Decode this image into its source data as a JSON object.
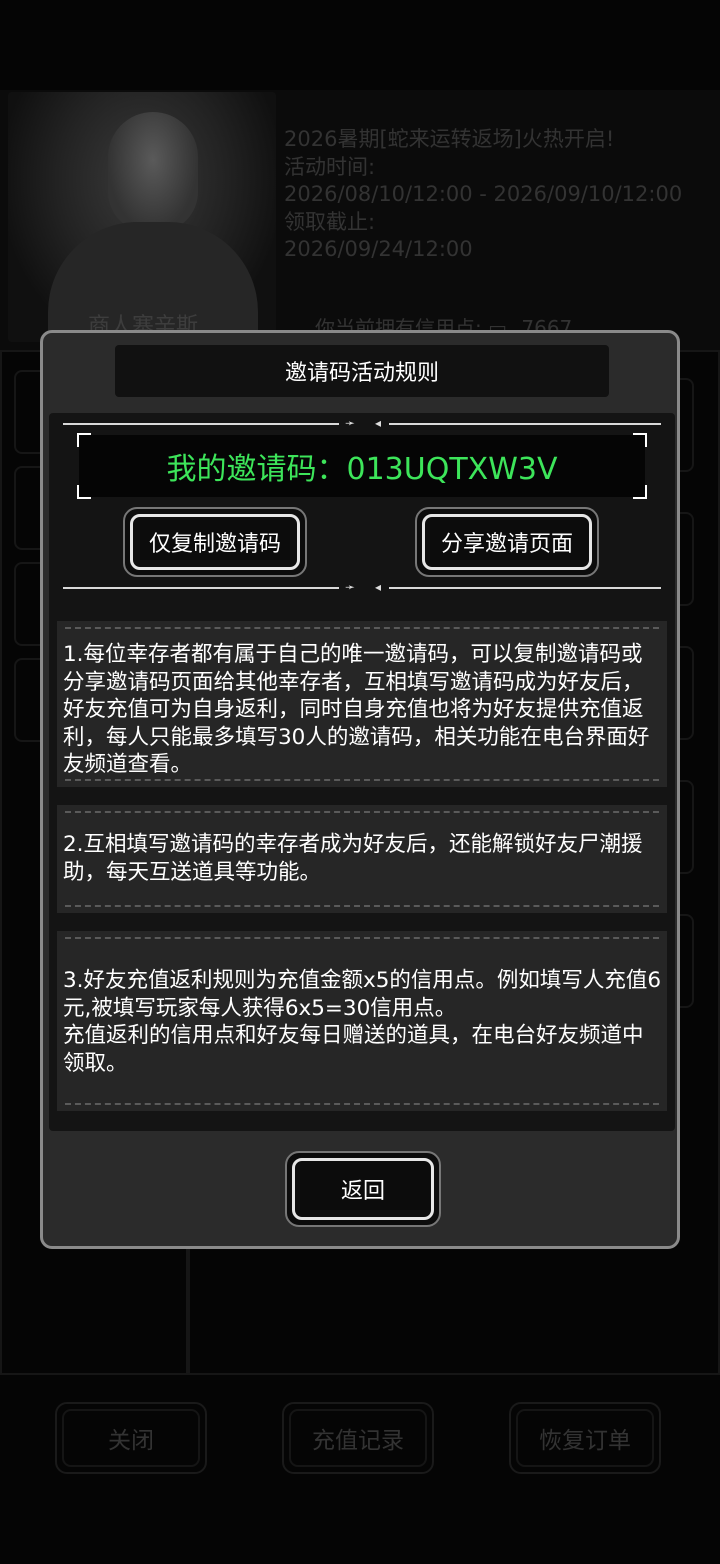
{
  "background": {
    "merchant_name": "商人塞辛斯",
    "event_lines": [
      "2026暑期[蛇来运转返场]火热开启!",
      "活动时间:",
      "2026/08/10/12:00 - 2026/09/10/12:00",
      "领取截止:",
      "2026/09/24/12:00"
    ],
    "credit_label": "你当前拥有信用点:",
    "credit_value": "7667",
    "bottom_buttons": [
      "关闭",
      "充值记录",
      "恢复订单"
    ]
  },
  "modal": {
    "title": "邀请码活动规则",
    "invite_code_text": "我的邀请码：013UQTXW3V",
    "copy_button": "仅复制邀请码",
    "share_button": "分享邀请页面",
    "rules": [
      "1.每位幸存者都有属于自己的唯一邀请码，可以复制邀请码或分享邀请码页面给其他幸存者，互相填写邀请码成为好友后，好友充值可为自身返利，同时自身充值也将为好友提供充值返利，每人只能最多填写30人的邀请码，相关功能在电台界面好友频道查看。",
      "2.互相填写邀请码的幸存者成为好友后，还能解锁好友尸潮援助，每天互送道具等功能。",
      "3.好友充值返利规则为充值金额x5的信用点。例如填写人充值6元,被填写玩家每人获得6x5=30信用点。\n充值返利的信用点和好友每日赠送的道具，在电台好友频道中领取。"
    ],
    "return_button": "返回"
  },
  "colors": {
    "invite_code": "#3de55a",
    "modal_border": "#8a8a8a",
    "modal_bg": "#2b2b2b"
  }
}
